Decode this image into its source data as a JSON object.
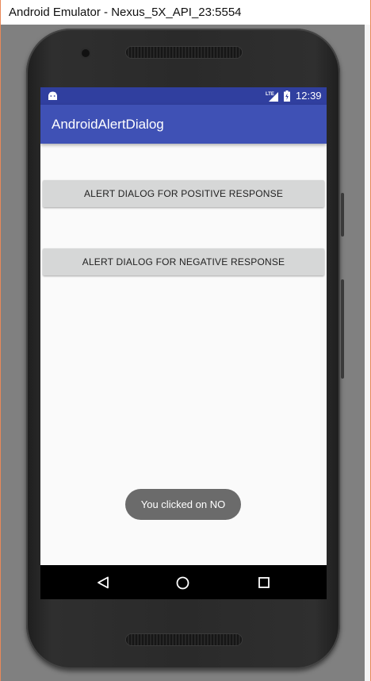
{
  "window": {
    "title": "Android Emulator - Nexus_5X_API_23:5554"
  },
  "statusbar": {
    "time": "12:39",
    "network_label": "LTE",
    "icons": [
      "android-icon",
      "lte-signal-icon",
      "battery-icon"
    ]
  },
  "appbar": {
    "title": "AndroidAlertDialog"
  },
  "buttons": {
    "positive_label": "ALERT DIALOG FOR POSITIVE RESPONSE",
    "negative_label": "ALERT DIALOG FOR NEGATIVE RESPONSE"
  },
  "toast": {
    "message": "You clicked on NO"
  },
  "navbar": {
    "icons": [
      "back-icon",
      "home-icon",
      "recents-icon"
    ]
  },
  "colors": {
    "statusbar": "#303f9f",
    "appbar": "#3f51b5",
    "button": "#d6d7d7",
    "toast": "#6b6b6b",
    "screen_background": "#fafafa"
  }
}
